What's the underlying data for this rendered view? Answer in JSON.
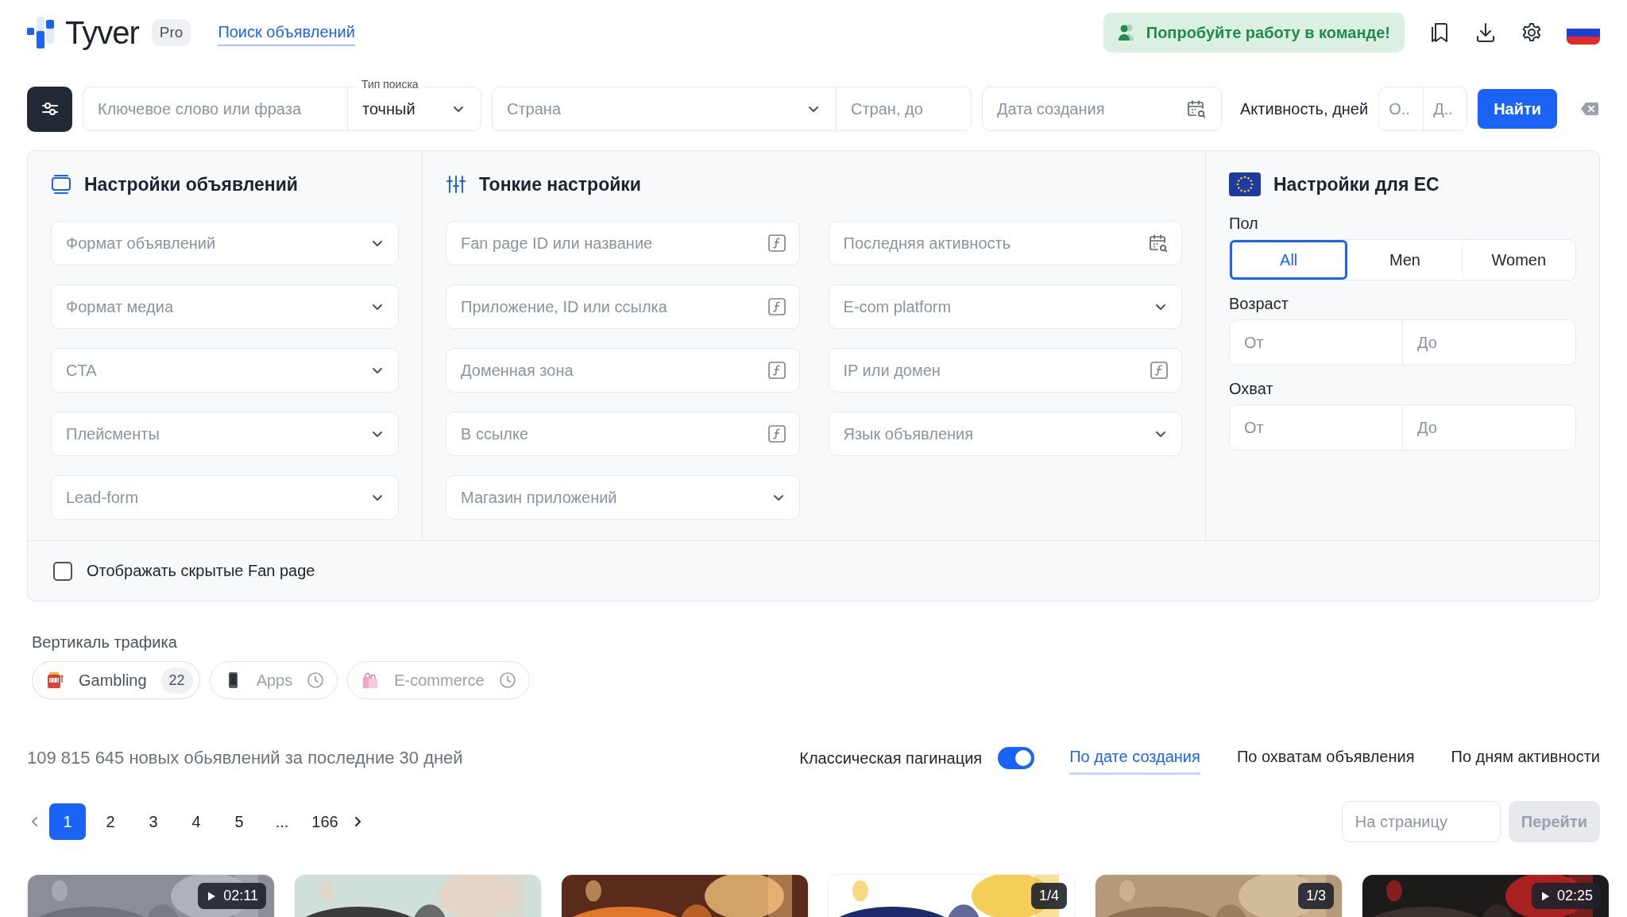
{
  "header": {
    "logo_text": "Tyver",
    "plan_badge": "Pro",
    "nav_link": {
      "label": "Поиск объявлений",
      "selected": true
    },
    "team_button": "Попробуйте работу в команде!"
  },
  "search_bar": {
    "keyword": {
      "placeholder": "Ключевое слово или фраза"
    },
    "search_type": {
      "label": "Тип поиска",
      "value": "точный"
    },
    "country": {
      "placeholder": "Страна"
    },
    "country_to": {
      "placeholder": "Стран, до"
    },
    "created_date": {
      "placeholder": "Дата создания"
    },
    "activity": {
      "label": "Активность, дней",
      "from_placeholder": "О..",
      "to_placeholder": "Д.."
    },
    "submit": "Найти"
  },
  "ad_settings": {
    "title": "Настройки объявлений",
    "fields": [
      {
        "placeholder": "Формат объявлений",
        "kind": "select"
      },
      {
        "placeholder": "Формат медиа",
        "kind": "select"
      },
      {
        "placeholder": "CTA",
        "kind": "select"
      },
      {
        "placeholder": "Плейсменты",
        "kind": "select"
      },
      {
        "placeholder": "Lead-form",
        "kind": "select"
      }
    ]
  },
  "fine_settings": {
    "title": "Тонкие настройки",
    "columns": [
      [
        {
          "placeholder": "Fan page ID или название",
          "kind": "text"
        },
        {
          "placeholder": "Приложение, ID или ссылка",
          "kind": "text"
        },
        {
          "placeholder": "Доменная зона",
          "kind": "text"
        },
        {
          "placeholder": "В ссылке",
          "kind": "text"
        },
        {
          "placeholder": "Магазин приложений",
          "kind": "select"
        }
      ],
      [
        {
          "placeholder": "Последняя активность",
          "kind": "date"
        },
        {
          "placeholder": "E-com platform",
          "kind": "select"
        },
        {
          "placeholder": "IP или домен",
          "kind": "text"
        },
        {
          "placeholder": "Язык объявления",
          "kind": "select"
        }
      ]
    ]
  },
  "eu_settings": {
    "title": "Настройки для ЕС",
    "gender": {
      "label": "Пол",
      "options": [
        {
          "label": "All",
          "selected": true
        },
        {
          "label": "Men",
          "selected": false
        },
        {
          "label": "Women",
          "selected": false
        }
      ]
    },
    "age": {
      "label": "Возраст",
      "from_placeholder": "От",
      "to_placeholder": "До"
    },
    "reach": {
      "label": "Охват",
      "from_placeholder": "От",
      "to_placeholder": "До"
    }
  },
  "show_hidden": {
    "label": "Отображать скрытые Fan page",
    "checked": false
  },
  "verticals": {
    "label": "Вертикаль трафика",
    "chips": [
      {
        "label": "Gambling",
        "kind": "slot",
        "count": "22",
        "disabled": false
      },
      {
        "label": "Apps",
        "kind": "phone",
        "disabled": true
      },
      {
        "label": "E-commerce",
        "kind": "bags",
        "disabled": true
      }
    ]
  },
  "summary": "109 815 645 новых обьявлений за последние 30 дней",
  "pagination_toggle": {
    "label": "Классическая пагинация",
    "on": true
  },
  "sort_tabs": [
    {
      "label": "По дате создания",
      "selected": true
    },
    {
      "label": "По охватам объявления",
      "selected": false
    },
    {
      "label": "По дням активности",
      "selected": false
    }
  ],
  "pages": [
    {
      "label": "1",
      "selected": true
    },
    {
      "label": "2",
      "selected": false
    },
    {
      "label": "3",
      "selected": false
    },
    {
      "label": "4",
      "selected": false
    },
    {
      "label": "5",
      "selected": false
    },
    {
      "label": "...",
      "selected": false
    },
    {
      "label": "166",
      "selected": false
    }
  ],
  "goto": {
    "placeholder": "На страницу",
    "button": "Перейти",
    "disabled": true
  },
  "cards": [
    {
      "kind": "picture",
      "badge": "02:11",
      "video": true
    },
    {
      "kind": "picture"
    },
    {
      "kind": "picture"
    },
    {
      "kind": "picture",
      "badge": "1/4",
      "video": false
    },
    {
      "kind": "picture",
      "badge": "1/3",
      "video": false
    },
    {
      "kind": "picture",
      "badge": "02:25",
      "video": true
    }
  ]
}
